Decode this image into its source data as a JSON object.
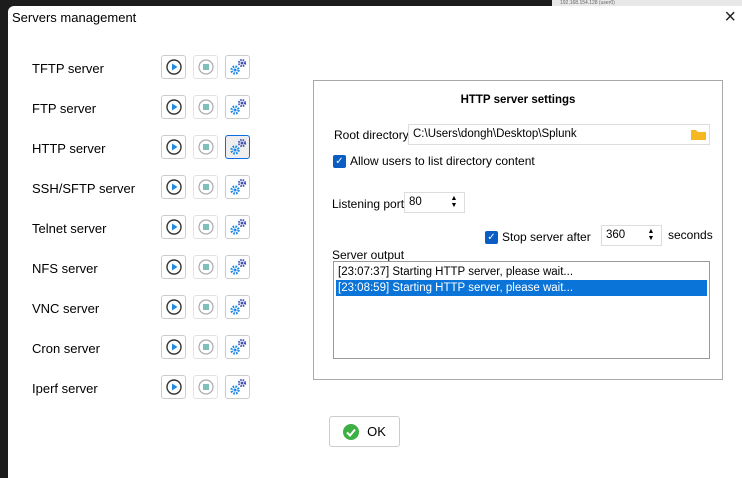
{
  "background_text": "192.168.154.128 (user0)",
  "window": {
    "title": "Servers management",
    "close_icon": "close-icon"
  },
  "servers": [
    {
      "label": "TFTP server"
    },
    {
      "label": "FTP server"
    },
    {
      "label": "HTTP server",
      "selected": true
    },
    {
      "label": "SSH/SFTP server"
    },
    {
      "label": "Telnet server"
    },
    {
      "label": "NFS server"
    },
    {
      "label": "VNC server"
    },
    {
      "label": "Cron server"
    },
    {
      "label": "Iperf server"
    }
  ],
  "settings": {
    "title": "HTTP server settings",
    "root_label": "Root directory",
    "root_value": "C:\\Users\\dongh\\Desktop\\Splunk",
    "allow_list_label": "Allow users to list directory content",
    "allow_list_checked": true,
    "port_label": "Listening port",
    "port_value": "80",
    "stop_label": "Stop server after",
    "stop_checked": true,
    "stop_value": "360",
    "stop_unit": "seconds",
    "output_label": "Server output",
    "output": [
      "[23:07:37] Starting HTTP server, please wait...",
      "[23:08:59] Starting HTTP server, please wait..."
    ],
    "selected_output_index": 1
  },
  "ok_label": "OK",
  "colors": {
    "accent": "#0a74d8",
    "play": "#1e88e5",
    "stop": "#7fbfba",
    "gear": "#3f51b5",
    "folder": "#f5b820",
    "ok": "#3cb043"
  }
}
